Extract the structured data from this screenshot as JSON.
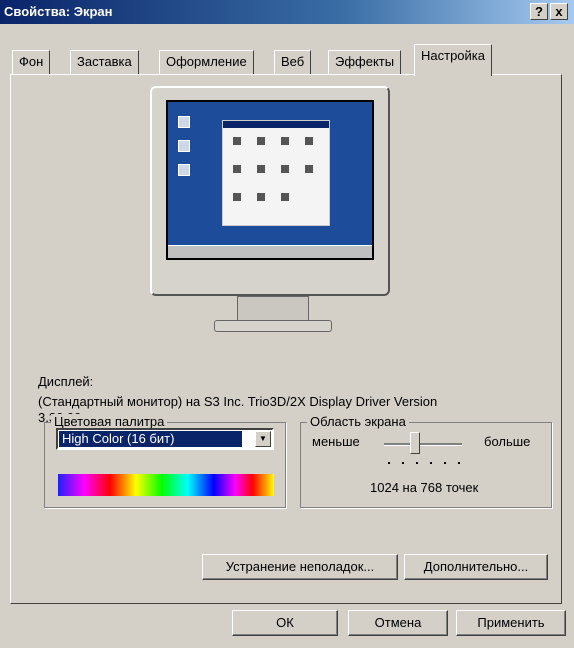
{
  "window": {
    "title": "Свойства: Экран",
    "help_label": "?",
    "close_label": "x"
  },
  "tabs": [
    {
      "label": "Фон"
    },
    {
      "label": "Заставка"
    },
    {
      "label": "Оформление"
    },
    {
      "label": "Веб"
    },
    {
      "label": "Эффекты"
    },
    {
      "label": "Настройка"
    }
  ],
  "display": {
    "label": "Дисплей:",
    "description": "(Стандартный монитор) на S3 Inc. Trio3D/2X Display Driver Version",
    "version": "3.30.09"
  },
  "color_palette": {
    "legend": "Цветовая палитра",
    "selected": "High Color (16 бит)"
  },
  "screen_area": {
    "legend": "Область экрана",
    "less_label": "меньше",
    "more_label": "больше",
    "resolution_text": "1024 на 768 точек",
    "slider_value": 0.4
  },
  "buttons": {
    "troubleshoot": "Устранение неполадок...",
    "advanced": "Дополнительно...",
    "ok": "ОК",
    "cancel": "Отмена",
    "apply": "Применить"
  },
  "colors": {
    "titlebar": "#0a246a",
    "face": "#d4d0c8",
    "desktop": "#1c4c9a"
  }
}
